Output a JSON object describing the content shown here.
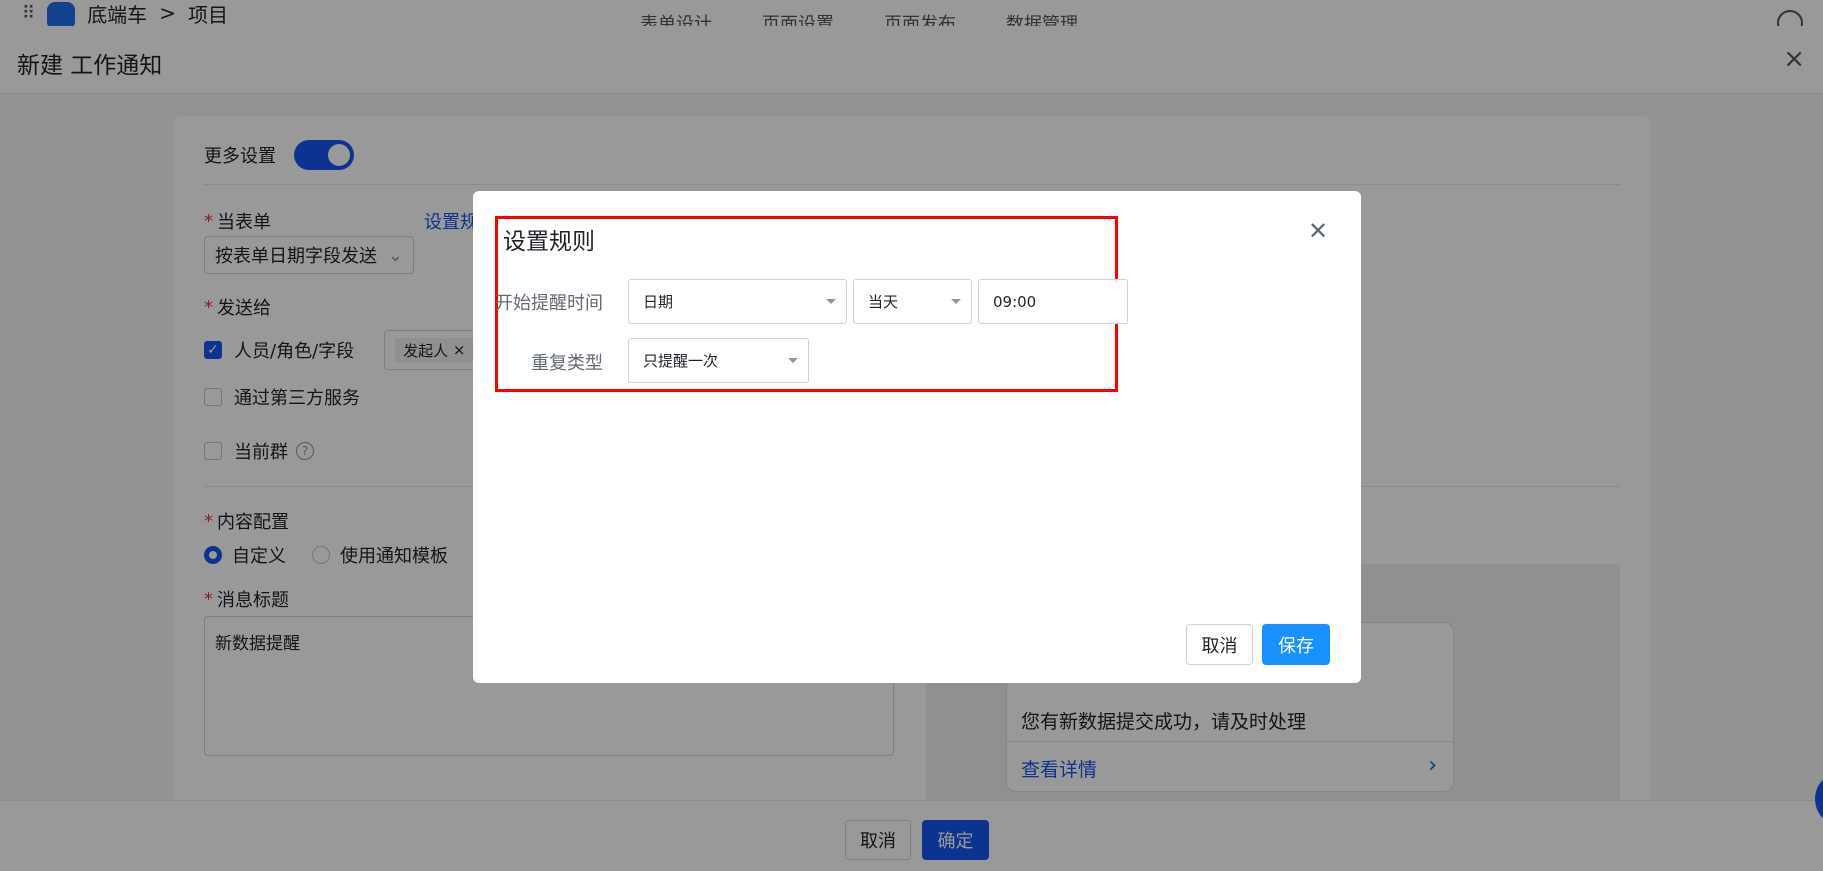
{
  "topbar": {
    "app_name": "底端车",
    "breadcrumb_sep": ">",
    "project": "项目",
    "nav": [
      "表单设计",
      "页面设置",
      "页面发布",
      "数据管理"
    ]
  },
  "dialog": {
    "title": "新建 工作通知",
    "close": "×"
  },
  "form": {
    "more_settings": "更多设置",
    "when_form_label": "当表单",
    "set_rule_link": "设置规",
    "date_field_select": "按表单日期字段发送",
    "send_to_label": "发送给",
    "send_options": [
      {
        "label": "人员/角色/字段",
        "checked": true
      },
      {
        "label": "通过第三方服务",
        "checked": false
      },
      {
        "label": "当前群",
        "checked": false
      }
    ],
    "initiator_tag": "发起人",
    "content_config_label": "内容配置",
    "content_options": [
      {
        "label": "自定义",
        "checked": true
      },
      {
        "label": "使用通知模板",
        "checked": false
      }
    ],
    "message_title_label": "消息标题",
    "message_title_value": "新数据提醒",
    "preview_message": "您有新数据提交成功，请及时处理",
    "preview_detail": "查看详情"
  },
  "footer": {
    "cancel": "取消",
    "confirm": "确定"
  },
  "modal": {
    "title": "设置规则",
    "start_time_label": "开始提醒时间",
    "date_select": "日期",
    "day_select": "当天",
    "time_input": "09:00",
    "repeat_type_label": "重复类型",
    "repeat_select": "只提醒一次",
    "cancel": "取消",
    "save": "保存"
  },
  "colors": {
    "primary": "#1456f0",
    "highlight": "#ff0000",
    "required": "#e33333",
    "save_button": "#1890ff"
  }
}
